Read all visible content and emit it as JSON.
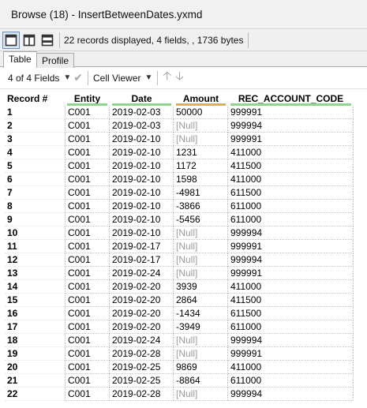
{
  "window": {
    "title": "Browse (18) - InsertBetweenDates.yxmd"
  },
  "toolbar": {
    "status": "22 records displayed, 4 fields, , 1736 bytes",
    "layout_icons": [
      "single-pane-icon",
      "split-vertical-icon",
      "split-horizontal-icon"
    ]
  },
  "tabs": [
    {
      "label": "Table",
      "active": true
    },
    {
      "label": "Profile",
      "active": false
    }
  ],
  "fieldbar": {
    "fields_selector": "4 of 4 Fields",
    "viewer_selector": "Cell Viewer"
  },
  "grid": {
    "columns": [
      {
        "label": "Record #",
        "accent": ""
      },
      {
        "label": "Entity",
        "accent": "#8fd48f"
      },
      {
        "label": "Date",
        "accent": "#8fd48f"
      },
      {
        "label": "Amount",
        "accent": "#f0a848"
      },
      {
        "label": "REC_ACCOUNT_CODE",
        "accent": "#8fd48f"
      }
    ],
    "rows": [
      [
        "1",
        "C001",
        "2019-02-03",
        "50000",
        "999991"
      ],
      [
        "2",
        "C001",
        "2019-02-03",
        "[Null]",
        "999994"
      ],
      [
        "3",
        "C001",
        "2019-02-10",
        "[Null]",
        "999991"
      ],
      [
        "4",
        "C001",
        "2019-02-10",
        "1231",
        "411000"
      ],
      [
        "5",
        "C001",
        "2019-02-10",
        "1172",
        "411500"
      ],
      [
        "6",
        "C001",
        "2019-02-10",
        "1598",
        "411000"
      ],
      [
        "7",
        "C001",
        "2019-02-10",
        "-4981",
        "611500"
      ],
      [
        "8",
        "C001",
        "2019-02-10",
        "-3866",
        "611000"
      ],
      [
        "9",
        "C001",
        "2019-02-10",
        "-5456",
        "611000"
      ],
      [
        "10",
        "C001",
        "2019-02-10",
        "[Null]",
        "999994"
      ],
      [
        "11",
        "C001",
        "2019-02-17",
        "[Null]",
        "999991"
      ],
      [
        "12",
        "C001",
        "2019-02-17",
        "[Null]",
        "999994"
      ],
      [
        "13",
        "C001",
        "2019-02-24",
        "[Null]",
        "999991"
      ],
      [
        "14",
        "C001",
        "2019-02-20",
        "3939",
        "411000"
      ],
      [
        "15",
        "C001",
        "2019-02-20",
        "2864",
        "411500"
      ],
      [
        "16",
        "C001",
        "2019-02-20",
        "-1434",
        "611500"
      ],
      [
        "17",
        "C001",
        "2019-02-20",
        "-3949",
        "611000"
      ],
      [
        "18",
        "C001",
        "2019-02-24",
        "[Null]",
        "999994"
      ],
      [
        "19",
        "C001",
        "2019-02-28",
        "[Null]",
        "999991"
      ],
      [
        "20",
        "C001",
        "2019-02-25",
        "9869",
        "411000"
      ],
      [
        "21",
        "C001",
        "2019-02-25",
        "-8864",
        "611000"
      ],
      [
        "22",
        "C001",
        "2019-02-28",
        "[Null]",
        "999994"
      ]
    ]
  }
}
